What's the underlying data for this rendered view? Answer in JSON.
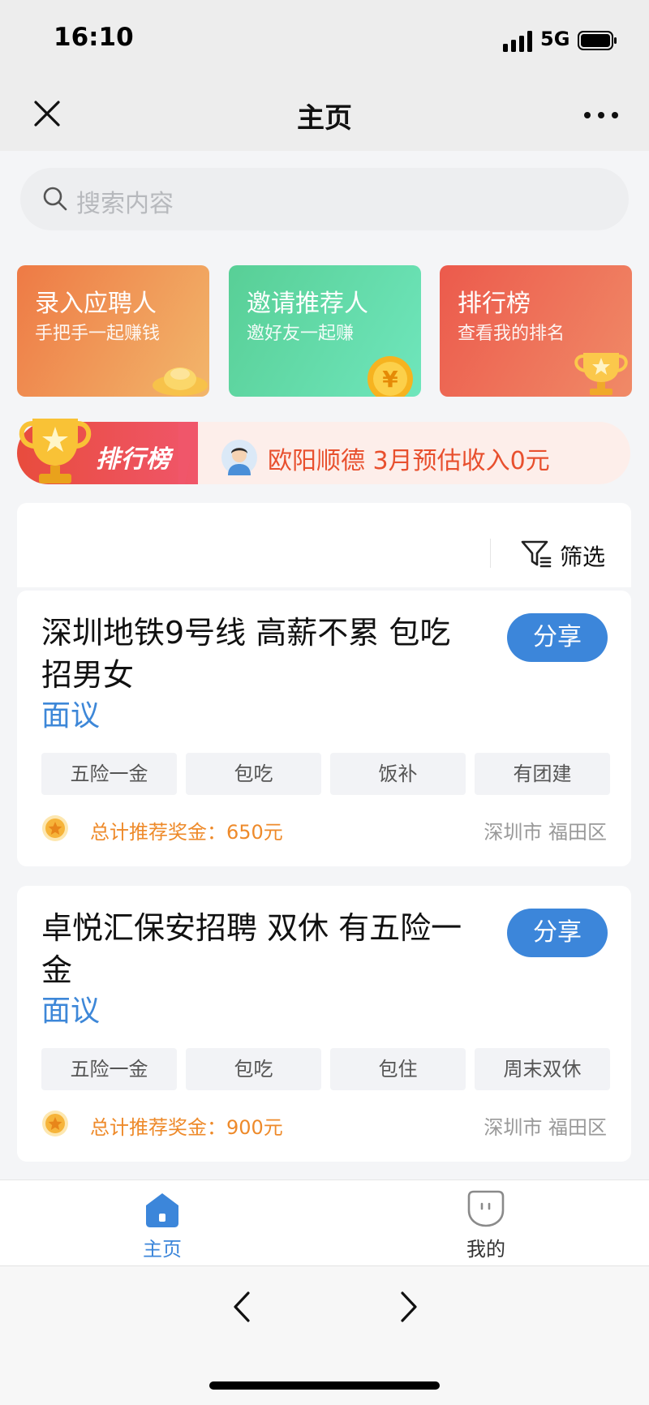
{
  "status_bar": {
    "time": "16:10",
    "network": "5G"
  },
  "nav": {
    "title": "主页"
  },
  "search": {
    "placeholder": "搜索内容"
  },
  "quick_cards": [
    {
      "title": "录入应聘人",
      "subtitle": "手把手一起赚钱",
      "icon": "gold-ingot-icon",
      "color": "#ee7a45"
    },
    {
      "title": "邀请推荐人",
      "subtitle": "邀好友一起赚",
      "icon": "yuan-coin-icon",
      "color": "#58cf96"
    },
    {
      "title": "排行榜",
      "subtitle": "查看我的排名",
      "icon": "trophy-icon",
      "color": "#ec5a4c"
    }
  ],
  "rank_banner": {
    "tag": "排行榜",
    "text": "欧阳顺德 3月预估收入0元"
  },
  "filter": {
    "label": "筛选"
  },
  "jobs": [
    {
      "title": "深圳地铁9号线 高薪不累 包吃招男女",
      "salary": "面议",
      "share_label": "分享",
      "tags": [
        "五险一金",
        "包吃",
        "饭补",
        "有团建"
      ],
      "bonus": "总计推荐奖金：650元",
      "location": "深圳市 福田区"
    },
    {
      "title": "卓悦汇保安招聘 双休 有五险一金",
      "salary": "面议",
      "share_label": "分享",
      "tags": [
        "五险一金",
        "包吃",
        "包住",
        "周末双休"
      ],
      "bonus": "总计推荐奖金：900元",
      "location": "深圳市 福田区"
    }
  ],
  "tabbar": {
    "home": "主页",
    "mine": "我的"
  },
  "colors": {
    "accent": "#3c86da",
    "bonus": "#ee8a2a",
    "rank_text": "#e8502e"
  }
}
